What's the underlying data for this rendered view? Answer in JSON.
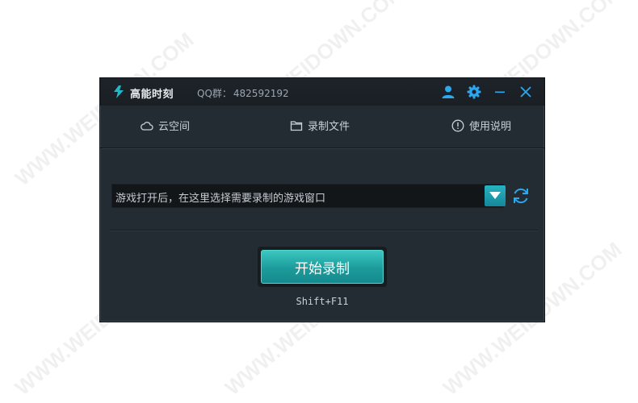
{
  "watermark": "WWW.WEIDOWN.COM",
  "titlebar": {
    "app_name": "高能时刻",
    "qq_label": "QQ群：",
    "qq_number": "482592192",
    "icons": [
      "user-icon",
      "gear-icon",
      "minimize-icon",
      "close-icon"
    ]
  },
  "nav": {
    "items": [
      {
        "label": "云空间",
        "icon": "cloud-icon"
      },
      {
        "label": "录制文件",
        "icon": "folder-icon"
      },
      {
        "label": "使用说明",
        "icon": "info-icon"
      }
    ]
  },
  "game_select": {
    "value": "游戏打开后，在这里选择需要录制的游戏窗口",
    "dropdown_icon": "chevron-down-icon",
    "refresh_icon": "refresh-icon"
  },
  "record": {
    "start_label": "开始录制",
    "shortcut": "Shift+F11"
  },
  "colors": {
    "accent": "#1fa3b1",
    "window_bg": "#232b33",
    "titlebar_bg": "#1c2227",
    "icon_blue": "#2aa8f0"
  }
}
